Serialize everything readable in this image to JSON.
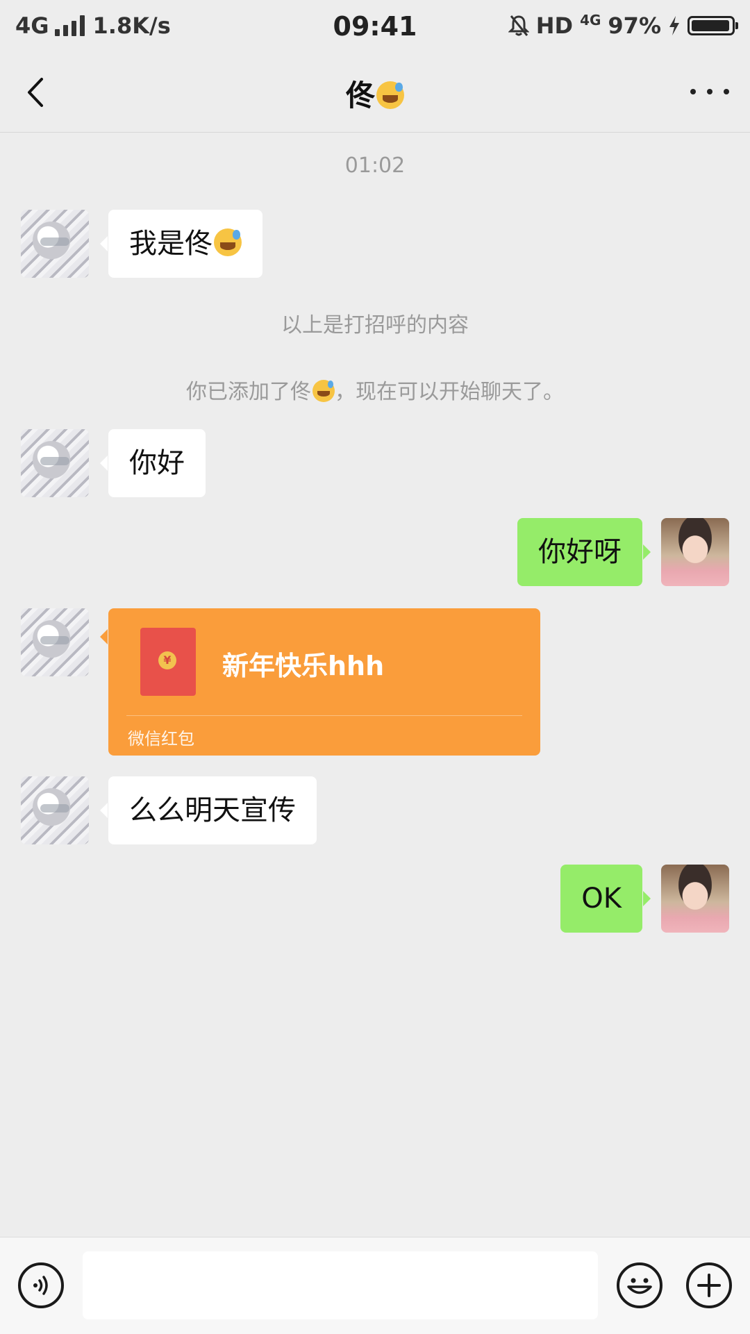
{
  "status_bar": {
    "network": "4G",
    "speed": "1.8K/s",
    "time": "09:41",
    "hd": "HD",
    "network_right": "4G",
    "battery_pct": "97%",
    "battery_level": 0.97
  },
  "nav": {
    "title": "佟",
    "title_emoji": "sweat-smile-emoji"
  },
  "chat": {
    "timestamp": "01:02",
    "greeting_msg": "我是佟",
    "greeting_note": "以上是打招呼的内容",
    "added_note_prefix": "你已添加了佟",
    "added_note_suffix": "，现在可以开始聊天了。",
    "msg_hello": "你好",
    "msg_hello_reply": "你好呀",
    "red_packet": {
      "title": "新年快乐hhh",
      "footer": "微信红包",
      "coin_symbol": "¥"
    },
    "msg_promo": "么么明天宣传",
    "msg_ok": "OK"
  },
  "colors": {
    "background": "#ededed",
    "bubble_in": "#ffffff",
    "bubble_out": "#95ec69",
    "red_packet": "#fa9d3b",
    "system_text": "#9a9a9a"
  },
  "input_bar": {
    "value": "",
    "voice_icon": "voice-icon",
    "emoji_icon": "emoji-icon",
    "plus_icon": "plus-icon"
  }
}
